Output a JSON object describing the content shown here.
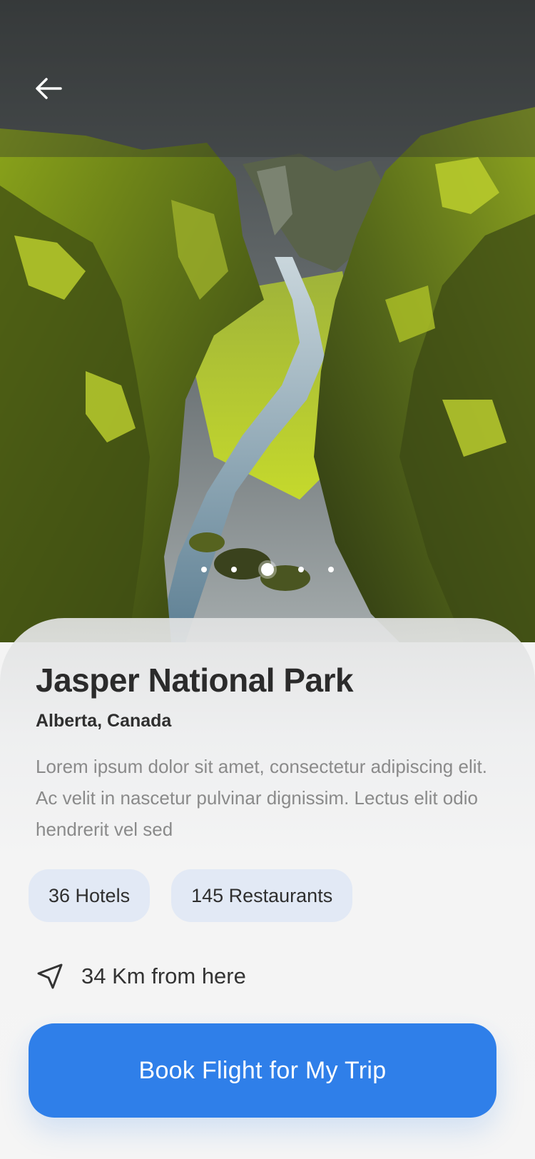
{
  "header": {
    "back_icon": "arrow-left-icon"
  },
  "carousel": {
    "total": 5,
    "active_index": 2
  },
  "place": {
    "name": "Jasper National Park",
    "location": "Alberta, Canada",
    "description": "Lorem ipsum dolor sit amet, consectetur adipiscing elit. Ac velit in nascetur pulvinar dignissim. Lectus elit odio hendrerit vel sed"
  },
  "stats": {
    "hotels": "36 Hotels",
    "restaurants": "145 Restaurants"
  },
  "distance": {
    "icon": "navigation-arrow-icon",
    "label": "34 Km from here"
  },
  "cta": {
    "label": "Book Flight for My Trip"
  },
  "colors": {
    "accent": "#2f7fe9",
    "chip_bg": "#e2e9f5"
  }
}
